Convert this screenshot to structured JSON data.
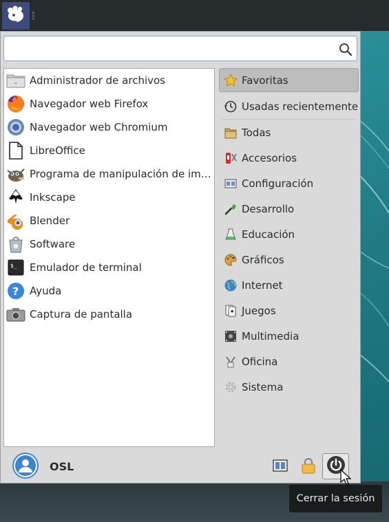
{
  "search": {
    "value": "",
    "placeholder": ""
  },
  "applications": [
    {
      "label": "Administrador de archivos",
      "icon": "file-manager-icon"
    },
    {
      "label": "Navegador web Firefox",
      "icon": "firefox-icon"
    },
    {
      "label": "Navegador web Chromium",
      "icon": "chromium-icon"
    },
    {
      "label": "LibreOffice",
      "icon": "libreoffice-icon"
    },
    {
      "label": "Programa de manipulación de imá…",
      "icon": "gimp-icon"
    },
    {
      "label": "Inkscape",
      "icon": "inkscape-icon"
    },
    {
      "label": "Blender",
      "icon": "blender-icon"
    },
    {
      "label": "Software",
      "icon": "software-center-icon"
    },
    {
      "label": "Emulador de terminal",
      "icon": "terminal-icon"
    },
    {
      "label": "Ayuda",
      "icon": "help-icon"
    },
    {
      "label": "Captura de pantalla",
      "icon": "screenshot-icon"
    }
  ],
  "categories": [
    {
      "label": "Favoritas",
      "icon": "star-icon",
      "active": true
    },
    {
      "label": "Usadas recientemente",
      "icon": "history-icon"
    },
    {
      "label": "Todas",
      "icon": "all-apps-icon"
    },
    {
      "label": "Accesorios",
      "icon": "accessories-icon"
    },
    {
      "label": "Configuración",
      "icon": "settings-icon"
    },
    {
      "label": "Desarrollo",
      "icon": "development-icon"
    },
    {
      "label": "Educación",
      "icon": "education-icon"
    },
    {
      "label": "Gráficos",
      "icon": "graphics-icon"
    },
    {
      "label": "Internet",
      "icon": "internet-globe-icon"
    },
    {
      "label": "Juegos",
      "icon": "games-icon"
    },
    {
      "label": "Multimedia",
      "icon": "multimedia-icon"
    },
    {
      "label": "Oficina",
      "icon": "office-icon"
    },
    {
      "label": "Sistema",
      "icon": "system-gear-icon"
    }
  ],
  "user": {
    "name": "OSL"
  },
  "tooltip": {
    "text": "Cerrar la sesión"
  },
  "colors": {
    "panel": "#262c2e",
    "menu_bg": "#dadada",
    "accent": "#3b83d6",
    "desktop": "#1f6f78"
  }
}
